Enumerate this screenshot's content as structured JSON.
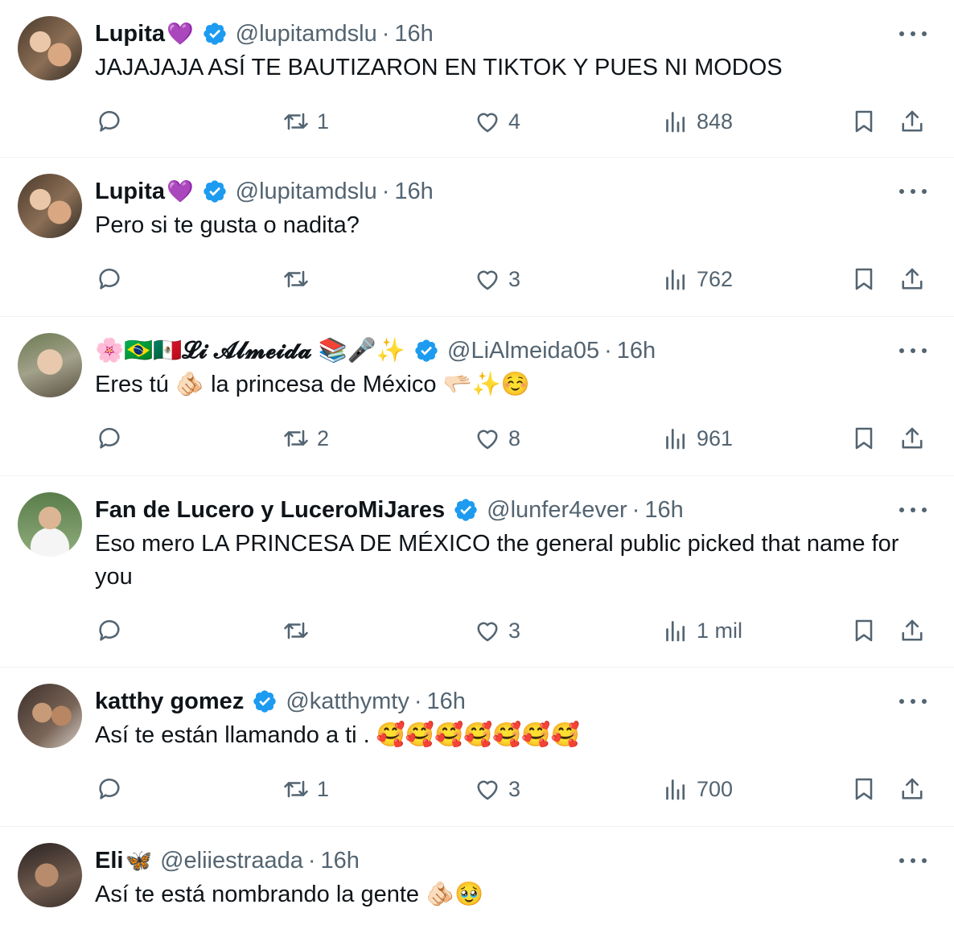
{
  "tweets": [
    {
      "display_name": "Lupita",
      "name_emoji": "💜",
      "handle": "@lupitamdslu",
      "time": "16h",
      "text": "JAJAJAJA ASÍ TE BAUTIZARON EN TIKTOK Y PUES NI MODOS",
      "retweets": "1",
      "likes": "4",
      "views": "848"
    },
    {
      "display_name": "Lupita",
      "name_emoji": "💜",
      "handle": "@lupitamdslu",
      "time": "16h",
      "text": "Pero si te gusta o nadita?",
      "retweets": "",
      "likes": "3",
      "views": "762"
    },
    {
      "display_name": "🌸🇧🇷🇲🇽𝓛𝓲 𝓐𝓵𝓶𝓮𝓲𝓭𝓪 📚🎤✨",
      "name_emoji": "",
      "handle": "@LiAlmeida05",
      "time": "16h",
      "text": "Eres tú 🫵🏻 la princesa de México 🫳🏻✨☺️",
      "retweets": "2",
      "likes": "8",
      "views": "961"
    },
    {
      "display_name": "Fan de Lucero y LuceroMiJares",
      "name_emoji": "",
      "handle": "@lunfer4ever",
      "time": "16h",
      "text": "Eso mero LA PRINCESA DE MÉXICO the general public picked that name for you",
      "retweets": "",
      "likes": "3",
      "views": "1 mil"
    },
    {
      "display_name": "katthy gomez",
      "name_emoji": "",
      "handle": "@katthymty",
      "time": "16h",
      "text": "Así te están llamando a ti . 🥰🥰🥰🥰🥰🥰🥰",
      "retweets": "1",
      "likes": "3",
      "views": "700"
    },
    {
      "display_name": "Eli",
      "name_emoji": "🦋",
      "handle": "@eliiestraada",
      "time": "16h",
      "text": "Así te está nombrando la gente 🫵🏻🥹",
      "retweets": "",
      "likes": "",
      "views": ""
    }
  ],
  "separator": "·",
  "colors": {
    "text": "#0f1419",
    "secondary": "#536471",
    "verified": "#1d9bf0",
    "divider": "#eff3f4"
  },
  "icons": [
    "reply-icon",
    "retweet-icon",
    "like-icon",
    "views-icon",
    "bookmark-icon",
    "share-icon",
    "verified-badge-icon",
    "more-icon"
  ]
}
